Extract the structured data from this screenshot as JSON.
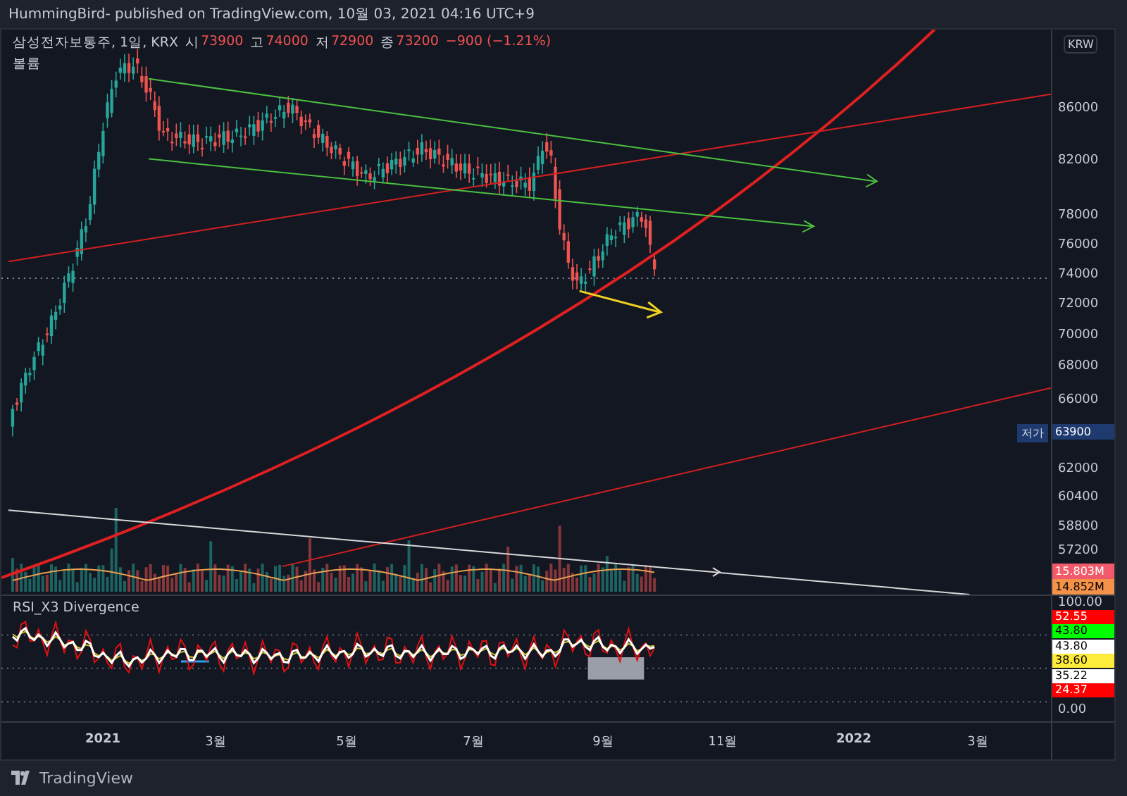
{
  "header": {
    "title": "HummingBird- published on TradingView.com, 10월 03, 2021 04:16 UTC+9"
  },
  "legend": {
    "symbol": "삼성전자보통주, 1일, KRX",
    "ohlc": [
      {
        "label": "시",
        "value": "73900"
      },
      {
        "label": "고",
        "value": "74000"
      },
      {
        "label": "저",
        "value": "72900"
      },
      {
        "label": "종",
        "value": "73200"
      }
    ],
    "change": "−900 (−1.21%)",
    "volume_label": "볼륨"
  },
  "price_axis": {
    "currency": "KRW",
    "labels": [
      "86000",
      "82000",
      "78000",
      "76000",
      "74000",
      "72000",
      "70000",
      "68000",
      "66000",
      "62000",
      "60400",
      "58800",
      "57200"
    ],
    "low_marker": {
      "label": "저가",
      "value": "63900"
    },
    "volume_badges": [
      {
        "value": "15.803M",
        "color": "#f05a6a"
      },
      {
        "value": "14.852M",
        "color": "#f5924a"
      }
    ]
  },
  "rsi": {
    "title": "RSI_X3 Divergence",
    "axis_labels": [
      "100.00",
      "0.00"
    ],
    "badges": [
      {
        "value": "52.55",
        "color": "#ff0000"
      },
      {
        "value": "43.80",
        "color": "#00ff00"
      },
      {
        "value": "43.80",
        "color": "#ffffff"
      },
      {
        "value": "38.60",
        "color": "#ffeb3b"
      },
      {
        "value": "35.22",
        "color": "#ffffff"
      },
      {
        "value": "24.37",
        "color": "#ff0000"
      }
    ]
  },
  "time_axis": [
    {
      "label": "2021",
      "bold": true
    },
    {
      "label": "3월",
      "bold": false
    },
    {
      "label": "5월",
      "bold": false
    },
    {
      "label": "7월",
      "bold": false
    },
    {
      "label": "9월",
      "bold": false
    },
    {
      "label": "11월",
      "bold": false
    },
    {
      "label": "2022",
      "bold": true
    },
    {
      "label": "3월",
      "bold": false
    }
  ],
  "footer": {
    "brand": "TradingView"
  }
}
